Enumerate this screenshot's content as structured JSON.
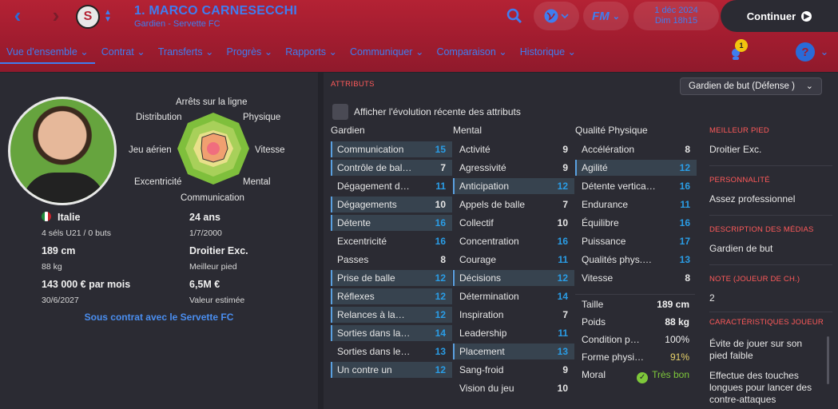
{
  "header": {
    "player_name": "1. MARCO CARNESECCHI",
    "player_sub": "Gardien - Servette FC",
    "crest_letter": "S",
    "fm_label": "FM",
    "date": "1 déc 2024",
    "time": "Dim 18h15",
    "continue_label": "Continuer",
    "notif_count": "1",
    "tabs": [
      {
        "label": "Vue d'ensemble"
      },
      {
        "label": "Contrat"
      },
      {
        "label": "Transferts"
      },
      {
        "label": "Progrès"
      },
      {
        "label": "Rapports"
      },
      {
        "label": "Communiquer"
      },
      {
        "label": "Comparaison"
      },
      {
        "label": "Historique"
      }
    ]
  },
  "overview": {
    "radar_labels": {
      "top": "Arrêts sur la ligne",
      "tl": "Distribution",
      "tr": "Physique",
      "l": "Jeu aérien",
      "r": "Vitesse",
      "bl": "Excentricité",
      "br": "Mental",
      "b": "Communication"
    },
    "nationality": "Italie",
    "caps": "4 séls U21 / 0 buts",
    "age": "24 ans",
    "dob": "1/7/2000",
    "height": "189 cm",
    "weight": "88 kg",
    "foot": "Droitier Exc.",
    "foot_label": "Meilleur pied",
    "wage": "143 000 € par mois",
    "contract_end": "30/6/2027",
    "value": "6,5M €",
    "value_label": "Valeur estimée",
    "contract_text": "Sous contrat avec le Servette FC"
  },
  "attributes": {
    "title": "ATTRIBUTS",
    "role_select": "Gardien de but (Défense )",
    "checkbox_label": "Afficher l'évolution récente des attributs",
    "col_gk": "Gardien",
    "col_mental": "Mental",
    "col_phys": "Qualité Physique",
    "gk": [
      {
        "name": "Communication",
        "value": "15"
      },
      {
        "name": "Contrôle de bal…",
        "value": "7"
      },
      {
        "name": "Dégagement d…",
        "value": "11"
      },
      {
        "name": "Dégagements",
        "value": "10"
      },
      {
        "name": "Détente",
        "value": "16"
      },
      {
        "name": "Excentricité",
        "value": "16"
      },
      {
        "name": "Passes",
        "value": "8"
      },
      {
        "name": "Prise de balle",
        "value": "12"
      },
      {
        "name": "Réflexes",
        "value": "12"
      },
      {
        "name": "Relances à la…",
        "value": "12"
      },
      {
        "name": "Sorties dans la…",
        "value": "14"
      },
      {
        "name": "Sorties dans le…",
        "value": "13"
      },
      {
        "name": "Un contre un",
        "value": "12"
      }
    ],
    "mental": [
      {
        "name": "Activité",
        "value": "9"
      },
      {
        "name": "Agressivité",
        "value": "9"
      },
      {
        "name": "Anticipation",
        "value": "12"
      },
      {
        "name": "Appels de balle",
        "value": "7"
      },
      {
        "name": "Collectif",
        "value": "10"
      },
      {
        "name": "Concentration",
        "value": "16"
      },
      {
        "name": "Courage",
        "value": "11"
      },
      {
        "name": "Décisions",
        "value": "12"
      },
      {
        "name": "Détermination",
        "value": "14"
      },
      {
        "name": "Inspiration",
        "value": "7"
      },
      {
        "name": "Leadership",
        "value": "11"
      },
      {
        "name": "Placement",
        "value": "13"
      },
      {
        "name": "Sang-froid",
        "value": "9"
      },
      {
        "name": "Vision du jeu",
        "value": "10"
      }
    ],
    "phys": [
      {
        "name": "Accélération",
        "value": "8"
      },
      {
        "name": "Agilité",
        "value": "12"
      },
      {
        "name": "Détente vertica…",
        "value": "16"
      },
      {
        "name": "Endurance",
        "value": "11"
      },
      {
        "name": "Équilibre",
        "value": "16"
      },
      {
        "name": "Puissance",
        "value": "17"
      },
      {
        "name": "Qualités phys.…",
        "value": "13"
      },
      {
        "name": "Vitesse",
        "value": "8"
      }
    ],
    "stats": [
      {
        "name": "Taille",
        "value": "189 cm"
      },
      {
        "name": "Poids",
        "value": "88 kg"
      },
      {
        "name": "Condition p…",
        "value": "100%"
      },
      {
        "name": "Forme physi…",
        "value": "91%"
      },
      {
        "name": "Moral",
        "value": "Très bon"
      }
    ]
  },
  "side": {
    "foot_h": "MEILLEUR PIED",
    "foot_v": "Droitier Exc.",
    "pers_h": "PERSONNALITÉ",
    "pers_v": "Assez professionnel",
    "media_h": "DESCRIPTION DES MÉDIAS",
    "media_v": "Gardien de but",
    "note_h": "NOTE (JOUEUR DE CH.)",
    "note_v": "2",
    "traits_h": "CARACTÉRISTIQUES JOUEUR",
    "trait1": "Évite de jouer sur son pied faible",
    "trait2": "Effectue des touches longues pour lancer des contre-attaques"
  },
  "colors": {
    "accent": "#3f7df0",
    "header": "#a11c2f",
    "value_blue": "#2a9de6",
    "section_red": "#ff5a5a",
    "good_green": "#7ec83a",
    "warn_yellow": "#e8d26a"
  }
}
